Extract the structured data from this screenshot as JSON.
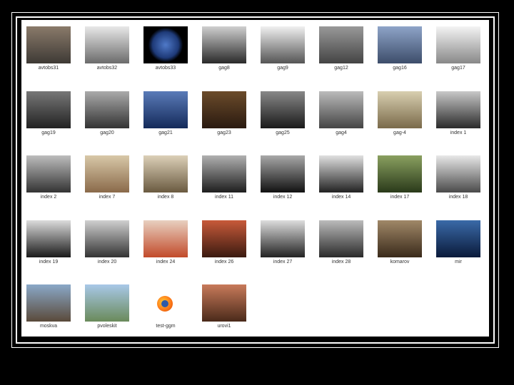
{
  "thumbnails": [
    {
      "label": "avtobs31",
      "icon": "group-photo-icon"
    },
    {
      "label": "avtobs32",
      "icon": "house-photo-icon"
    },
    {
      "label": "avtobs33",
      "icon": "earth-photo-icon"
    },
    {
      "label": "gag8",
      "icon": "portrait-photo-icon"
    },
    {
      "label": "gag9",
      "icon": "capsule-photo-icon"
    },
    {
      "label": "gag12",
      "icon": "team-photo-icon"
    },
    {
      "label": "gag16",
      "icon": "jet-photo-icon"
    },
    {
      "label": "gag17",
      "icon": "rocket-photo-icon"
    },
    {
      "label": "gag19",
      "icon": "family-photo-icon"
    },
    {
      "label": "gag20",
      "icon": "pilot-photo-icon"
    },
    {
      "label": "gag21",
      "icon": "satellite-photo-icon"
    },
    {
      "label": "gag23",
      "icon": "dashboard-photo-icon"
    },
    {
      "label": "gag25",
      "icon": "ceremony-photo-icon"
    },
    {
      "label": "gag4",
      "icon": "group-photo-icon"
    },
    {
      "label": "gag-4",
      "icon": "building-photo-icon"
    },
    {
      "label": "index 1",
      "icon": "boy-portrait-icon"
    },
    {
      "label": "index 2",
      "icon": "portrait-photo-icon"
    },
    {
      "label": "index 7",
      "icon": "statue-photo-icon"
    },
    {
      "label": "index 8",
      "icon": "person-photo-icon"
    },
    {
      "label": "index 11",
      "icon": "uniform-portrait-icon"
    },
    {
      "label": "index 12",
      "icon": "smiling-portrait-icon"
    },
    {
      "label": "index 14",
      "icon": "officer-photo-icon"
    },
    {
      "label": "index 17",
      "icon": "officer-color-photo-icon"
    },
    {
      "label": "index 18",
      "icon": "cockpit-photo-icon"
    },
    {
      "label": "index 19",
      "icon": "cosmonaut-helmet-icon"
    },
    {
      "label": "index 20",
      "icon": "two-people-photo-icon"
    },
    {
      "label": "index 24",
      "icon": "spacesuit-photo-icon"
    },
    {
      "label": "index 26",
      "icon": "spacesuit-photo-icon"
    },
    {
      "label": "index 27",
      "icon": "crowd-photo-icon"
    },
    {
      "label": "index 28",
      "icon": "billiards-photo-icon"
    },
    {
      "label": "komarov",
      "icon": "group-photo-icon"
    },
    {
      "label": "mir",
      "icon": "space-station-photo-icon"
    },
    {
      "label": "moskva",
      "icon": "city-photo-icon"
    },
    {
      "label": "pvoleskit",
      "icon": "landscape-photo-icon"
    },
    {
      "label": "test-ggm",
      "icon": "firefox-icon"
    },
    {
      "label": "urovi1",
      "icon": "spacesuit-photo-icon"
    }
  ],
  "colors": {
    "background": "#000000",
    "panel": "#ffffff",
    "frame": "#ffffff"
  }
}
